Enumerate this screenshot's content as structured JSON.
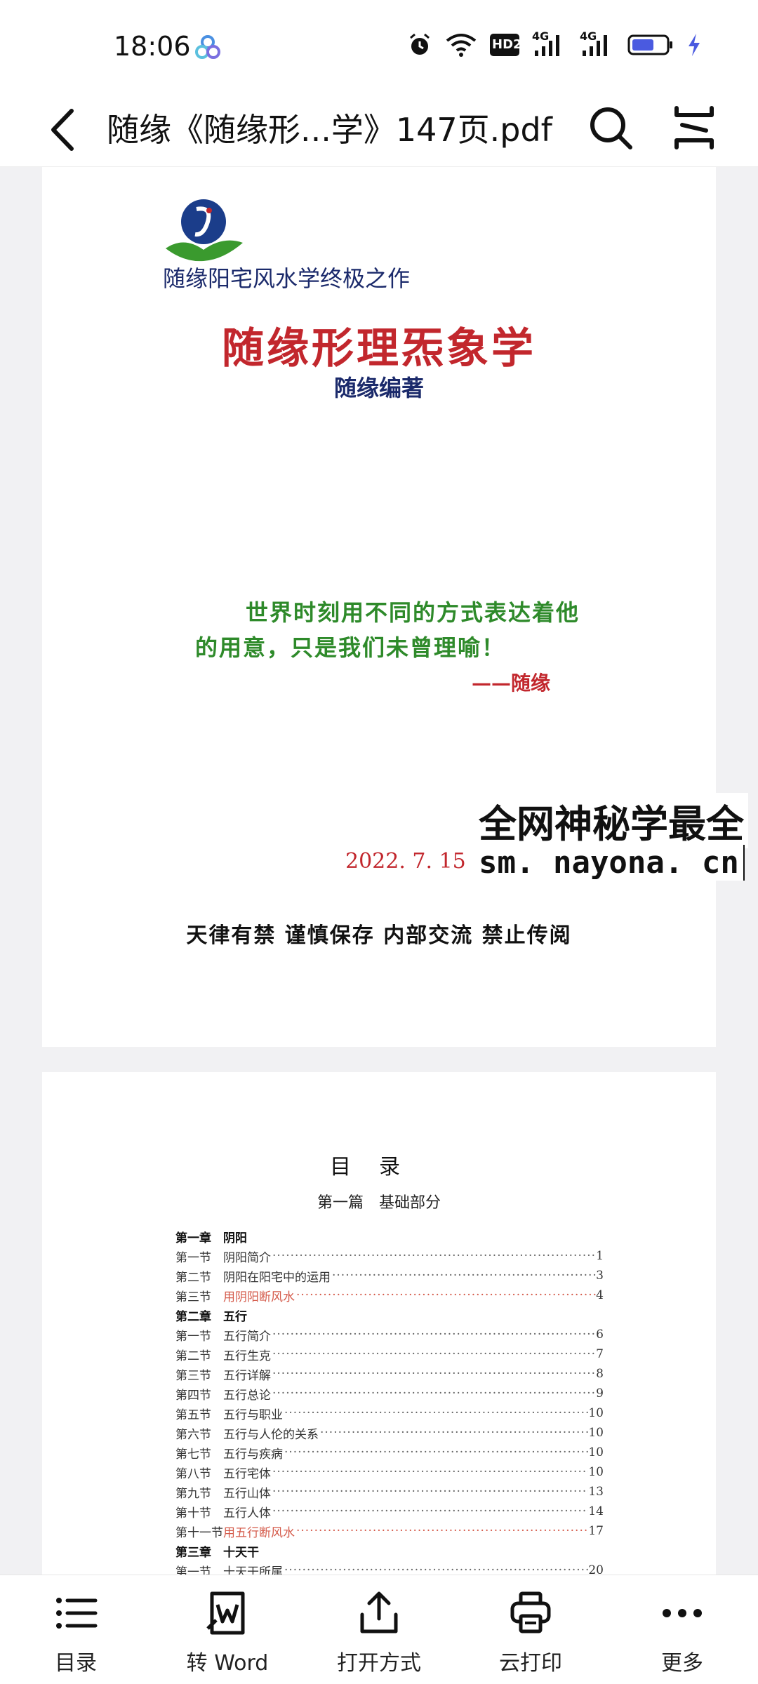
{
  "status_bar": {
    "time": "18:06",
    "hd_label": "HD2",
    "network1": "4G",
    "network2": "4G",
    "icons": [
      "alarm-icon",
      "wifi-icon",
      "hd-voice-icon",
      "signal-icon",
      "signal-icon",
      "battery-icon",
      "charging-icon"
    ]
  },
  "title_bar": {
    "title": "随缘《随缘形...学》147页.pdf"
  },
  "page1": {
    "subtitle": "随缘阳宅风水学终极之作",
    "title": "随缘形理炁象学",
    "author": "随缘编著",
    "quote_line1": "世界时刻用不同的方式表达着他",
    "quote_line2": "的用意，只是我们未曾理喻！",
    "quote_signature": "——随缘",
    "date": "2022. 7. 15",
    "footer": "天律有禁  谨慎保存  内部交流  禁止传阅"
  },
  "watermark": {
    "title": "全网神秘学最全",
    "url": "sm. nayona. cn"
  },
  "page2": {
    "toc_title": "目录",
    "part": "第一篇　基础部分",
    "entries": [
      {
        "num": "第一章",
        "name": "阴阳",
        "page": "",
        "type": "chapter"
      },
      {
        "num": "第一节",
        "name": "阴阳简介",
        "page": "1",
        "type": "section"
      },
      {
        "num": "第二节",
        "name": "阴阳在阳宅中的运用",
        "page": "3",
        "type": "section"
      },
      {
        "num": "第三节",
        "name": "用阴阳断风水",
        "page": "4",
        "type": "highlight"
      },
      {
        "num": "第二章",
        "name": "五行",
        "page": "",
        "type": "chapter"
      },
      {
        "num": "第一节",
        "name": "五行简介",
        "page": "6",
        "type": "section"
      },
      {
        "num": "第二节",
        "name": "五行生克",
        "page": "7",
        "type": "section"
      },
      {
        "num": "第三节",
        "name": "五行详解",
        "page": "8",
        "type": "section"
      },
      {
        "num": "第四节",
        "name": "五行总论",
        "page": "9",
        "type": "section"
      },
      {
        "num": "第五节",
        "name": "五行与职业",
        "page": "10",
        "type": "section"
      },
      {
        "num": "第六节",
        "name": "五行与人伦的关系",
        "page": "10",
        "type": "section"
      },
      {
        "num": "第七节",
        "name": "五行与疾病",
        "page": "10",
        "type": "section"
      },
      {
        "num": "第八节",
        "name": "五行宅体",
        "page": "10",
        "type": "section"
      },
      {
        "num": "第九节",
        "name": "五行山体",
        "page": "13",
        "type": "section"
      },
      {
        "num": "第十节",
        "name": "五行人体",
        "page": "14",
        "type": "section"
      },
      {
        "num": "第十一节",
        "name": "用五行断风水",
        "page": "17",
        "type": "highlight"
      },
      {
        "num": "第三章",
        "name": "十天干",
        "page": "",
        "type": "chapter"
      },
      {
        "num": "第一节",
        "name": "十天干所属",
        "page": "20",
        "type": "section"
      }
    ]
  },
  "bottom_bar": {
    "items": [
      {
        "label": "目录",
        "icon": "list-icon"
      },
      {
        "label": "转 Word",
        "icon": "word-convert-icon"
      },
      {
        "label": "打开方式",
        "icon": "share-icon"
      },
      {
        "label": "云打印",
        "icon": "printer-icon"
      },
      {
        "label": "更多",
        "icon": "more-icon"
      }
    ]
  }
}
